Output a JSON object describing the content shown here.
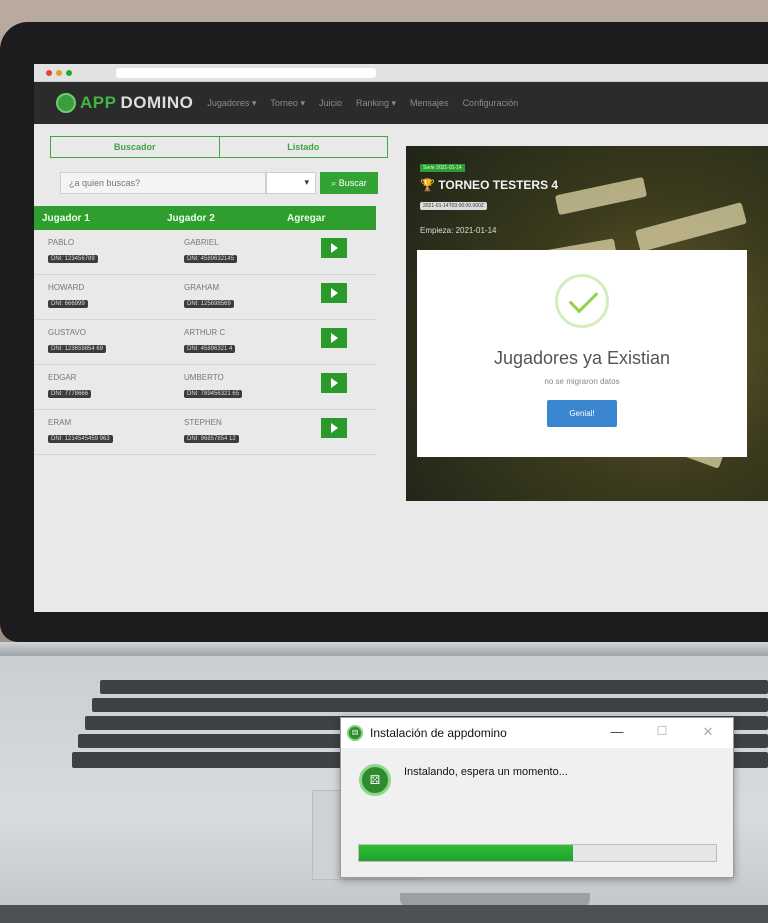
{
  "app": {
    "logo_app": "APP",
    "logo_name": "DOMINO",
    "nav": [
      "Jugadores ▾",
      "Torneo ▾",
      "Juicio",
      "Ranking ▾",
      "Mensajes",
      "Configuración"
    ]
  },
  "left_panel": {
    "tabs": [
      "Buscador",
      "Listado"
    ],
    "search_placeholder": "¿a quien buscas?",
    "search_button": "Buscar",
    "columns": [
      "Jugador 1",
      "Jugador 2",
      "Agregar"
    ],
    "rows": [
      {
        "p1": "PABLO",
        "id1": "DNI: 123456789",
        "p2": "GABRIEL",
        "id2": "DNI: 4589632145"
      },
      {
        "p1": "HOWARD",
        "id1": "DNI: 666999",
        "p2": "GRAHAM",
        "id2": "DNI: 125698569"
      },
      {
        "p1": "GUSTAVO",
        "id1": "DNI: 123659854 69",
        "p2": "ARTHUR C",
        "id2": "DNI: 45896321 4"
      },
      {
        "p1": "EDGAR",
        "id1": "DNI: 7778666",
        "p2": "UMBERTO",
        "id2": "DNI: 789456321 65"
      },
      {
        "p1": "ERAM",
        "id1": "DNI: 1214545459 963",
        "p2": "STEPHEN",
        "id2": "DNI: 96857854 12"
      }
    ]
  },
  "tournament": {
    "badge": "Serie 2021-01-14",
    "title": "TORNEO TESTERS 4",
    "date_tag": "2021-01-14T03:00:00.000Z",
    "start": "Empieza: 2021-01-14"
  },
  "modal": {
    "title": "Jugadores ya Existian",
    "subtitle": "no se migraron datos",
    "button": "Genial!"
  },
  "installer": {
    "title": "Instalación de appdomino",
    "status": "Instalando, espera un momento...",
    "progress_fraction": 0.6,
    "controls": [
      "—",
      "☐",
      "✕"
    ]
  }
}
